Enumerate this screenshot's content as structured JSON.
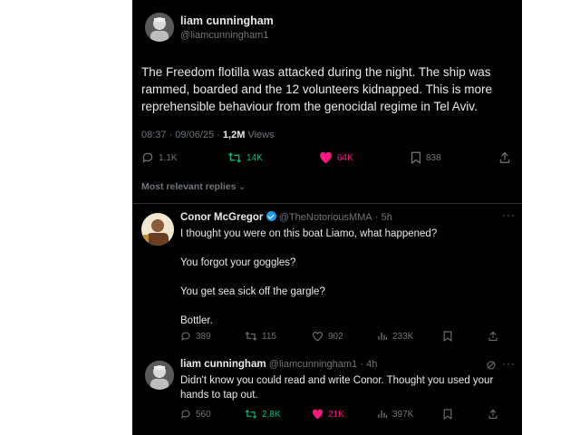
{
  "tweet": {
    "author_name": "liam cunningham",
    "author_handle": "@liamcunningham1",
    "text_lines": [
      "The Freedom flotilla was attacked during the night. The ship was",
      "rammed, boarded and the 12 volunteers kidnapped. This is more",
      "reprehensible behaviour from the genocidal regime in Tel Aviv."
    ],
    "timestamp": "08:37 · 09/06/25 · ",
    "views_count": "1,2M",
    "views_label": " Views",
    "replies": "1,1K",
    "reposts": "14K",
    "likes": "64K",
    "bookmarks": "838"
  },
  "sort_label": "Most relevant replies",
  "replies": [
    {
      "author_name": "Conor McGregor",
      "author_handle": "@TheNotoriousMMA",
      "time": "· 5h",
      "lines": [
        "I thought you were on this boat Liamo, what happened?",
        "",
        "You forgot your goggles?",
        "",
        "You get sea sick off the gargle?",
        "",
        "Bottler."
      ],
      "replies": "389",
      "reposts": "115",
      "likes": "902",
      "views": "233K"
    },
    {
      "author_name": "liam cunningham",
      "author_handle": "@liamcunningham1",
      "time": "· 4h",
      "lines": [
        "Didn't know you could read and write Conor. Thought you used your",
        "hands to tap out."
      ],
      "replies": "560",
      "reposts": "2,8K",
      "likes": "21K",
      "views": "397K"
    }
  ],
  "colors": {
    "repost_active": "#00ba7c",
    "like_active": "#f91880",
    "muted": "#71767b",
    "text": "#e7e9ea"
  }
}
